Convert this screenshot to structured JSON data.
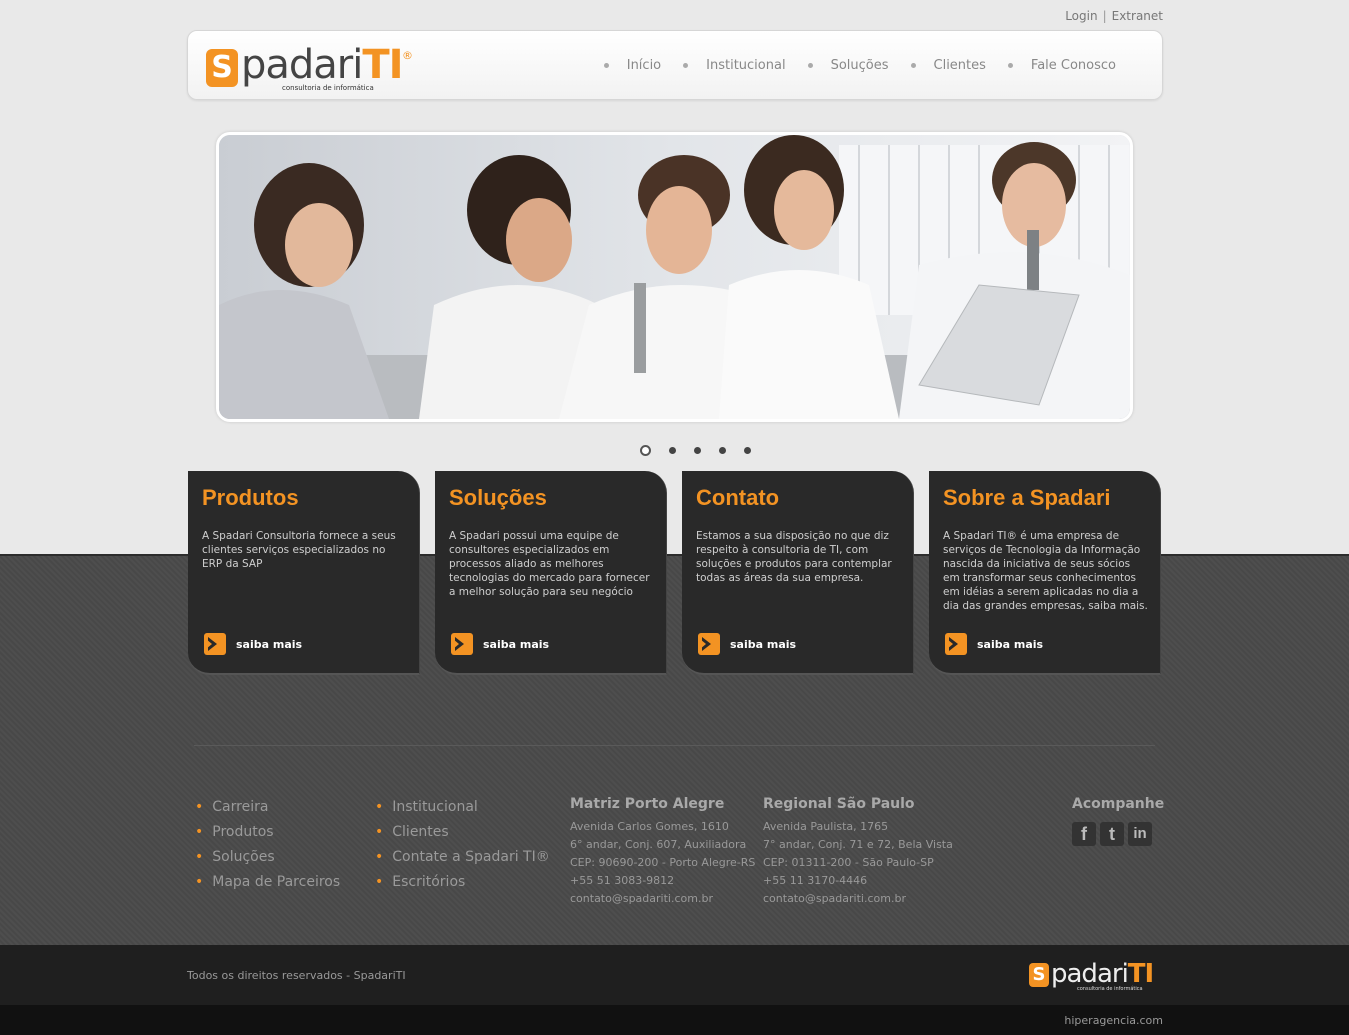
{
  "utility": {
    "login": "Login",
    "separator": "|",
    "extranet": "Extranet"
  },
  "logo": {
    "s": "S",
    "word": "padari",
    "ti": "TI",
    "reg": "®",
    "tagline": "consultoria de informática"
  },
  "nav": [
    {
      "label": "Início"
    },
    {
      "label": "Institucional"
    },
    {
      "label": "Soluções"
    },
    {
      "label": "Clientes"
    },
    {
      "label": "Fale Conosco"
    }
  ],
  "slider": {
    "active_index": 1,
    "count": 5
  },
  "cards": [
    {
      "title": "Produtos",
      "text": "A Spadari Consultoria fornece a seus clientes serviços especializados no ERP da SAP",
      "more": "saiba mais"
    },
    {
      "title": "Soluções",
      "text": "A Spadari possui uma equipe de consultores especializados em processos aliado as melhores tecnologias do mercado para fornecer a melhor solução para seu negócio",
      "more": "saiba mais"
    },
    {
      "title": "Contato",
      "text": "Estamos a sua disposição no que diz respeito à consultoria de TI, com soluções e produtos para contemplar todas as áreas da sua empresa.",
      "more": "saiba mais"
    },
    {
      "title": "Sobre a Spadari",
      "text": "A Spadari TI® é uma empresa de serviços de Tecnologia da Informação nascida da iniciativa de seus sócios em transformar seus conhecimentos em idéias a serem aplicadas no dia a dia das grandes empresas, saiba mais.",
      "more": "saiba mais"
    }
  ],
  "footer_links_1": [
    "Carreira",
    "Produtos",
    "Soluções",
    "Mapa de Parceiros"
  ],
  "footer_links_2": [
    "Institucional",
    "Clientes",
    "Contate a Spadari TI®",
    "Escritórios"
  ],
  "offices": [
    {
      "title": "Matriz Porto Alegre",
      "lines": [
        "Avenida Carlos Gomes, 1610",
        "6° andar, Conj. 607, Auxiliadora",
        "CEP: 90690-200 - Porto Alegre-RS",
        "+55 51 3083-9812",
        "contato@spadariti.com.br"
      ]
    },
    {
      "title": "Regional São Paulo",
      "lines": [
        "Avenida Paulista, 1765",
        "7° andar, Conj. 71 e 72, Bela Vista",
        "CEP: 01311-200 - São Paulo-SP",
        "+55 11 3170-4446",
        "contato@spadariti.com.br"
      ]
    }
  ],
  "follow": {
    "title": "Acompanhe",
    "icons": [
      {
        "name": "facebook-icon",
        "glyph": "f"
      },
      {
        "name": "twitter-icon",
        "glyph": "t"
      },
      {
        "name": "linkedin-icon",
        "glyph": "in"
      }
    ]
  },
  "footer": {
    "copyright": "Todos os direitos reservados - SpadariTI",
    "credit": "hiperagencia.com"
  },
  "colors": {
    "accent": "#f39323",
    "dark_card": "#292929",
    "mid_band": "#4a4a4a"
  }
}
